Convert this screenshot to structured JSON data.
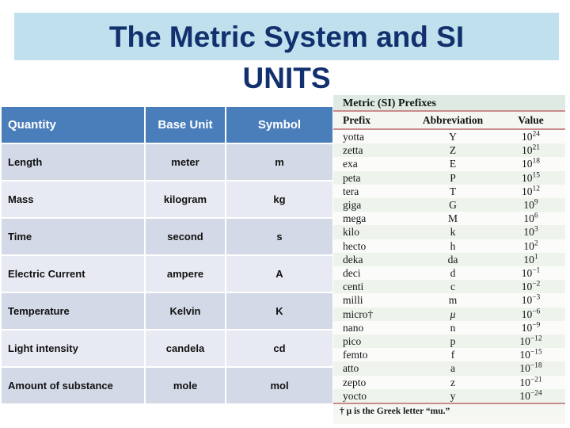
{
  "slide": {
    "title_line1": "The Metric System and SI",
    "title_line2": "UNITS",
    "title_band_color": "#bfe0ec",
    "title_text_color": "#13306e"
  },
  "base_units": {
    "header_bg": "#4a7ebb",
    "row_bg_odd": "#d3d9e7",
    "row_bg_even": "#e8eaf3",
    "columns": [
      "Quantity",
      "Base Unit",
      "Symbol"
    ],
    "rows": [
      {
        "quantity": "Length",
        "unit": "meter",
        "symbol": "m"
      },
      {
        "quantity": "Mass",
        "unit": "kilogram",
        "symbol": "kg"
      },
      {
        "quantity": "Time",
        "unit": "second",
        "symbol": "s"
      },
      {
        "quantity": "Electric Current",
        "unit": "ampere",
        "symbol": "A"
      },
      {
        "quantity": "Temperature",
        "unit": "Kelvin",
        "symbol": "K"
      },
      {
        "quantity": "Light intensity",
        "unit": "candela",
        "symbol": "cd"
      },
      {
        "quantity": "Amount of substance",
        "unit": "mole",
        "symbol": "mol"
      }
    ]
  },
  "prefixes": {
    "title": "Metric (SI) Prefixes",
    "rule_color": "#c98b8b",
    "columns": [
      "Prefix",
      "Abbreviation",
      "Value"
    ],
    "footnote": "† μ is the Greek letter “mu.”",
    "rows": [
      {
        "prefix": "yotta",
        "abbreviation": "Y",
        "base": "10",
        "exponent": "24"
      },
      {
        "prefix": "zetta",
        "abbreviation": "Z",
        "base": "10",
        "exponent": "21"
      },
      {
        "prefix": "exa",
        "abbreviation": "E",
        "base": "10",
        "exponent": "18"
      },
      {
        "prefix": "peta",
        "abbreviation": "P",
        "base": "10",
        "exponent": "15"
      },
      {
        "prefix": "tera",
        "abbreviation": "T",
        "base": "10",
        "exponent": "12"
      },
      {
        "prefix": "giga",
        "abbreviation": "G",
        "base": "10",
        "exponent": "9"
      },
      {
        "prefix": "mega",
        "abbreviation": "M",
        "base": "10",
        "exponent": "6"
      },
      {
        "prefix": "kilo",
        "abbreviation": "k",
        "base": "10",
        "exponent": "3"
      },
      {
        "prefix": "hecto",
        "abbreviation": "h",
        "base": "10",
        "exponent": "2"
      },
      {
        "prefix": "deka",
        "abbreviation": "da",
        "base": "10",
        "exponent": "1"
      },
      {
        "prefix": "deci",
        "abbreviation": "d",
        "base": "10",
        "exponent": "−1"
      },
      {
        "prefix": "centi",
        "abbreviation": "c",
        "base": "10",
        "exponent": "−2"
      },
      {
        "prefix": "milli",
        "abbreviation": "m",
        "base": "10",
        "exponent": "−3"
      },
      {
        "prefix": "micro†",
        "abbreviation": "μ",
        "base": "10",
        "exponent": "−6"
      },
      {
        "prefix": "nano",
        "abbreviation": "n",
        "base": "10",
        "exponent": "−9"
      },
      {
        "prefix": "pico",
        "abbreviation": "p",
        "base": "10",
        "exponent": "−12"
      },
      {
        "prefix": "femto",
        "abbreviation": "f",
        "base": "10",
        "exponent": "−15"
      },
      {
        "prefix": "atto",
        "abbreviation": "a",
        "base": "10",
        "exponent": "−18"
      },
      {
        "prefix": "zepto",
        "abbreviation": "z",
        "base": "10",
        "exponent": "−21"
      },
      {
        "prefix": "yocto",
        "abbreviation": "y",
        "base": "10",
        "exponent": "−24"
      }
    ]
  }
}
